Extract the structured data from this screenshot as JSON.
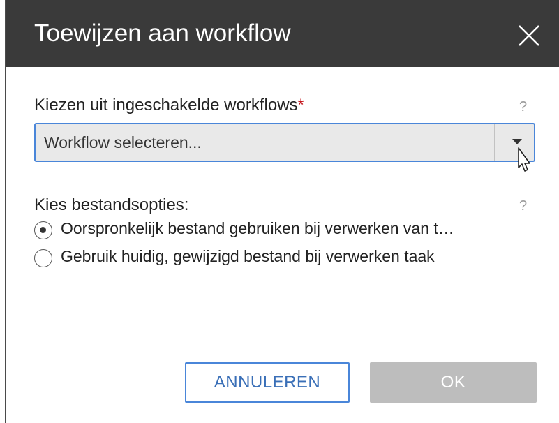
{
  "dialog": {
    "title": "Toewijzen aan workflow",
    "close_icon": "close-icon"
  },
  "workflow_section": {
    "label": "Kiezen uit ingeschakelde workflows",
    "required_marker": "*",
    "help": "?",
    "select": {
      "value": "Workflow selecteren...",
      "arrow_icon": "caret-down-icon"
    }
  },
  "file_options": {
    "label": "Kies bestandsopties:",
    "help": "?",
    "options": [
      {
        "label": "Oorspronkelijk bestand gebruiken bij verwerken van t…",
        "checked": true
      },
      {
        "label": "Gebruik huidig, gewijzigd bestand bij verwerken taak",
        "checked": false
      }
    ]
  },
  "footer": {
    "cancel_label": "ANNULEREN",
    "ok_label": "OK"
  },
  "colors": {
    "header_bg": "#3a3a3a",
    "accent": "#4a86d9",
    "required": "#c4161c",
    "disabled_button": "#bdbdbd"
  }
}
